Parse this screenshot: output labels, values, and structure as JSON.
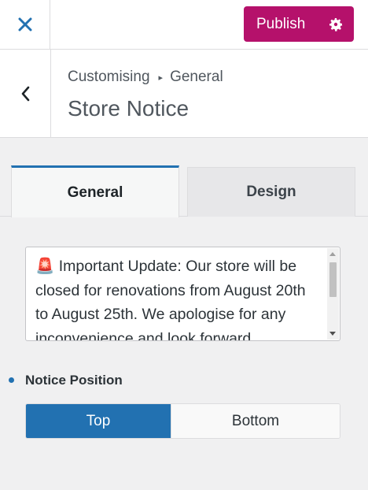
{
  "topbar": {
    "close_icon": "close-icon",
    "publish_label": "Publish",
    "gear_icon": "gear-icon",
    "accent_color": "#b5116b",
    "close_color": "#2271b1"
  },
  "header": {
    "back_icon": "chevron-left-icon",
    "breadcrumb": [
      "Customising",
      "General"
    ],
    "breadcrumb_separator": "▸",
    "title": "Store Notice"
  },
  "tabs": [
    {
      "label": "General",
      "active": true
    },
    {
      "label": "Design",
      "active": false
    }
  ],
  "notice": {
    "emoji": "🚨",
    "text": "Important Update: Our store will be closed for renovations from August 20th to August 25th. We apologise for any inconvenience and look forward"
  },
  "position": {
    "label": "Notice Position",
    "options": [
      "Top",
      "Bottom"
    ],
    "selected": "Top",
    "accent_color": "#2271b1"
  }
}
